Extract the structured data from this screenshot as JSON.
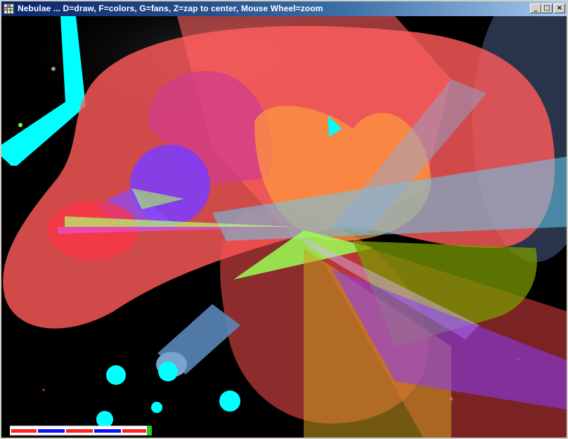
{
  "window": {
    "title": "Nebulae ... D=draw, F=colors, G=fans, Z=zap to center, Mouse Wheel=zoom",
    "min_glyph": "_",
    "max_glyph": "□",
    "close_glyph": "×"
  },
  "icons": {
    "app": "grid-app-icon",
    "minimize": "minimize-icon",
    "maximize": "maximize-icon",
    "close": "close-icon"
  },
  "scene": {
    "type": "3d-render",
    "background": "#000000",
    "colors": {
      "red": "#ff5a5a",
      "cyan": "#00ffff",
      "purple": "#7a3cff",
      "green": "#9aff55",
      "orange": "#ff9a3c",
      "olive": "#8a9a10",
      "steel": "#6a9ac8",
      "slate": "#3a4a6a"
    }
  },
  "progress": {
    "colors": [
      "#ff2020",
      "#ffffff",
      "#1010ff"
    ]
  }
}
